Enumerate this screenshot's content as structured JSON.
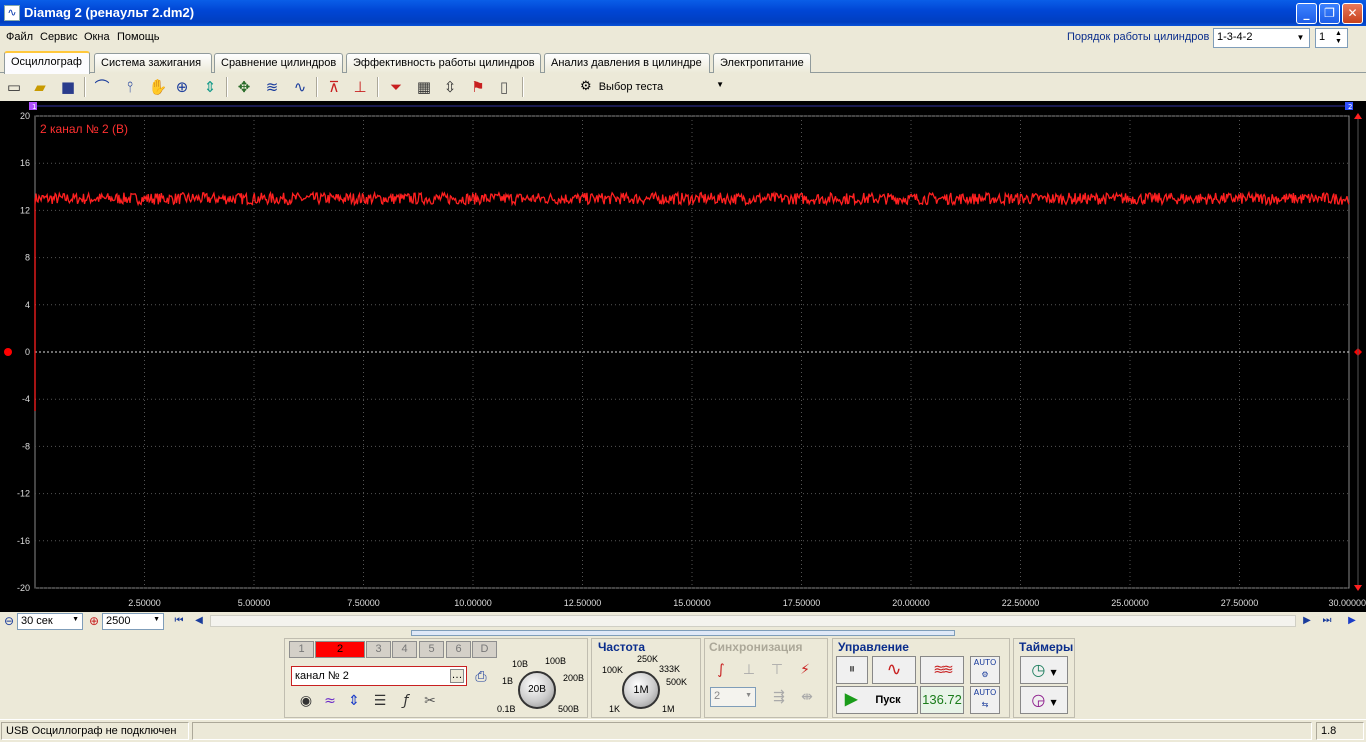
{
  "window": {
    "title": "Diamag 2 (ренаульт 2.dm2)",
    "icon": "waveform-icon"
  },
  "menu": [
    "Файл",
    "Сервис",
    "Окна",
    "Помощь"
  ],
  "cylinder_order": {
    "label": "Порядок работы цилиндров",
    "value": "1-3-4-2",
    "spin_value": "1"
  },
  "tabs": [
    "Осциллограф",
    "Система зажигания",
    "Сравнение цилиндров",
    "Эффективность работы цилиндров",
    "Анализ давления в цилиндре",
    "Электропитание"
  ],
  "active_tab": 0,
  "toolbar": {
    "test_select": "Выбор теста"
  },
  "chart_data": {
    "type": "line",
    "title": "2  канал № 2 (В)",
    "y_ticks": [
      "20",
      "16",
      "12",
      "8",
      "4",
      "0",
      "-4",
      "-8",
      "-12",
      "-16",
      "-20"
    ],
    "x_ticks": [
      "2.50000",
      "5.00000",
      "7.50000",
      "10.00000",
      "12.50000",
      "15.00000",
      "17.50000",
      "20.00000",
      "22.50000",
      "25.00000",
      "27.50000",
      "30.00000"
    ],
    "xlim": [
      0,
      30
    ],
    "ylim": [
      -20,
      20
    ],
    "series": [
      {
        "color": "#ff2020",
        "level": 13,
        "noise": 0.5
      }
    ],
    "zero_line": true,
    "grid": true,
    "markers": {
      "left": "1",
      "right": "2"
    }
  },
  "timebase": {
    "time": "30 сек",
    "samples": "2500"
  },
  "channels": {
    "labels": [
      "1",
      "2",
      "3",
      "4",
      "5",
      "6",
      "D"
    ],
    "active": "2",
    "name": "канал № 2"
  },
  "voltage_knob": {
    "value": "20В",
    "labels": [
      "10В",
      "100В",
      "1В",
      "200В",
      "0.1В",
      "500В"
    ]
  },
  "frequency": {
    "title": "Частота",
    "value": "1M",
    "labels": [
      "250K",
      "100K",
      "333K",
      "500K",
      "1K",
      "1M"
    ]
  },
  "sync": {
    "title": "Синхронизация",
    "channel": "2"
  },
  "control": {
    "title": "Управление",
    "start": "Пуск",
    "value": "136.72",
    "auto": "АUTO"
  },
  "timers": {
    "title": "Таймеры"
  },
  "status": {
    "message": "USB Осциллограф не подключен",
    "version": "1.8"
  }
}
